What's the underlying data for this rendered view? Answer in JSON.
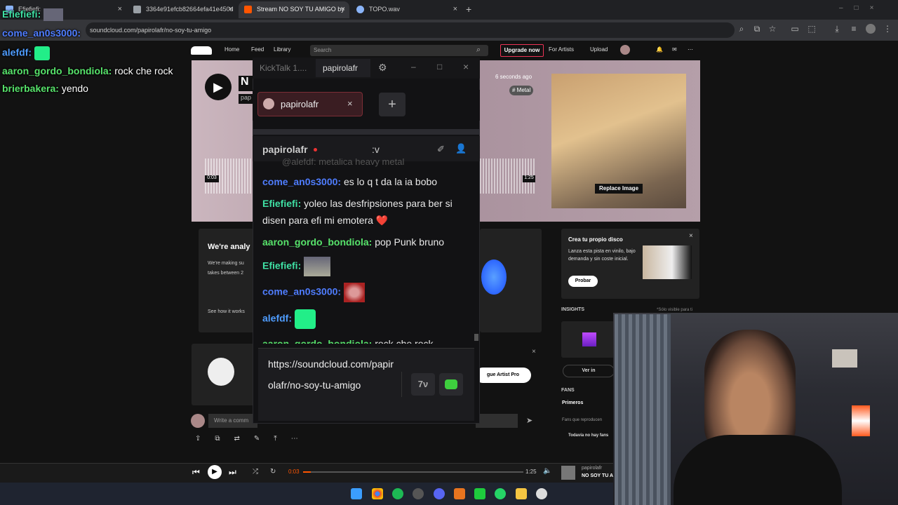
{
  "browser": {
    "tabs": [
      {
        "label": "Efiefiefi: ",
        "color": "#8ab4f8"
      },
      {
        "label": "3364e91efcb82664efa41e450d",
        "color": "#9aa0a6"
      },
      {
        "label": "Stream NO SOY TU AMIGO by",
        "color": "#ff5500"
      },
      {
        "label": "TOPO.wav",
        "color": "#8ab4f8"
      }
    ],
    "url": "soundcloud.com/papirolafr/no-soy-tu-amigo",
    "new_tab": "+"
  },
  "soundcloud": {
    "nav": {
      "home": "Home",
      "feed": "Feed",
      "library": "Library",
      "search_placeholder": "Search",
      "upgrade": "Upgrade now",
      "for_artists": "For Artists",
      "upload": "Upload"
    },
    "hero": {
      "title": "N",
      "artist": "pap",
      "posted": "6 seconds ago",
      "tag": "# Metal",
      "replace_image": "Replace Image",
      "time_start": "0:03",
      "time_end": "1:25"
    },
    "panel_left": {
      "heading": "We're analy",
      "line1": "We're making su",
      "line2": "takes between 2",
      "link": "See how it works"
    },
    "promo": {
      "title": "Crea tu propio disco",
      "body": "Lanza esta pista en vinilo, bajo demanda y sin coste inicial.",
      "button": "Probar",
      "close": "×"
    },
    "insights": {
      "label": "INSIGHTS",
      "note": "*Sólo visible para ti",
      "ver": "Ver in"
    },
    "fans": {
      "label": "FANS",
      "tab": "Primeros",
      "sub": "Fans que reproducen",
      "empty": "Todavía no hay fans"
    },
    "artist_pro": "gue Artist Pro",
    "comment_placeholder": "Write a comm",
    "player": {
      "elapsed": "0:03",
      "total": "1:25",
      "artist": "papirolafr",
      "track": "NO SOY TU AM",
      "progress": 0.035
    }
  },
  "overlay_chat": [
    {
      "user": "Efiefiefi:",
      "text": "",
      "color": "#3fe0a4"
    },
    {
      "user": "come_an0s3000:",
      "text": "",
      "color": "#4f7dff"
    },
    {
      "user": "alefdf:",
      "text": "",
      "color": "#4f9dff"
    },
    {
      "user": "aaron_gordo_bondiola:",
      "text": " rock che rock",
      "color": "#57e36b"
    },
    {
      "user": "brierbakera:",
      "text": " yendo",
      "color": "#57e36b"
    }
  ],
  "kicktalk": {
    "title": "KickTalk 1....",
    "channel_tab": "papirolafr",
    "chip": "papirolafr",
    "chip_close": "×",
    "add": "+",
    "window_controls": {
      "min": "–",
      "max": "□",
      "close": "×"
    },
    "channel_name": "papirolafr",
    "status": ":v",
    "cut_message": "@alefdf: metalica heavy metal",
    "messages": [
      {
        "user": "come_an0s3000:",
        "text": " es lo q t da la ia bobo",
        "color": "#4f7dff"
      },
      {
        "user": "Efiefiefi:",
        "text": " yoleo las desfripsiones para ber si disen para efi mi emotera ❤️",
        "color": "#3fe0a4"
      },
      {
        "user": "aaron_gordo_bondiola:",
        "text": " pop Punk bruno",
        "color": "#57e36b"
      },
      {
        "user": "Efiefiefi:",
        "text": "",
        "color": "#3fe0a4"
      },
      {
        "user": "come_an0s3000:",
        "text": "",
        "color": "#4f7dff"
      },
      {
        "user": "alefdf:",
        "text": "",
        "color": "#4f9dff"
      },
      {
        "user": "aaron_gordo_bondiola:",
        "text": " rock che rock",
        "color": "#57e36b"
      }
    ],
    "input_text": "https://soundcloud.com/papirolafr/no-soy-tu-amigo",
    "close_x": "×"
  }
}
